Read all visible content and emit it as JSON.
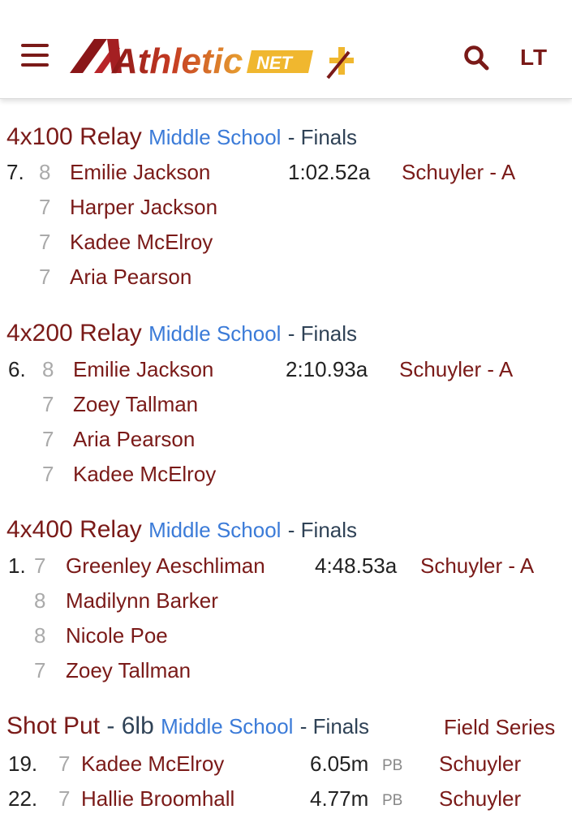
{
  "header": {
    "menu_icon": "hamburger-menu-icon",
    "logo": {
      "text_athletic": "Athletic",
      "text_net": "NET",
      "plus": "+"
    },
    "search_icon": "search-icon",
    "user_initials": "LT",
    "colors": {
      "brand": "#7a1a18",
      "accent": "#f0b72f",
      "link": "#3b7bd8"
    }
  },
  "events": [
    {
      "name": "4x100 Relay",
      "level": "Middle School",
      "round": "- Finals",
      "place": "7.",
      "mark": "1:02.52a",
      "team": "Schuyler - A",
      "athletes": [
        {
          "grade": "8",
          "name": "Emilie Jackson"
        },
        {
          "grade": "7",
          "name": "Harper Jackson"
        },
        {
          "grade": "7",
          "name": "Kadee McElroy"
        },
        {
          "grade": "7",
          "name": "Aria Pearson"
        }
      ]
    },
    {
      "name": "4x200 Relay",
      "level": "Middle School",
      "round": "- Finals",
      "place": "6.",
      "mark": "2:10.93a",
      "team": "Schuyler - A",
      "athletes": [
        {
          "grade": "8",
          "name": "Emilie Jackson"
        },
        {
          "grade": "7",
          "name": "Zoey Tallman"
        },
        {
          "grade": "7",
          "name": "Aria Pearson"
        },
        {
          "grade": "7",
          "name": "Kadee McElroy"
        }
      ]
    },
    {
      "name": "4x400 Relay",
      "level": "Middle School",
      "round": "- Finals",
      "place": "1.",
      "mark": "4:48.53a",
      "team": "Schuyler - A",
      "athletes": [
        {
          "grade": "7",
          "name": "Greenley Aeschliman"
        },
        {
          "grade": "8",
          "name": "Madilynn Barker"
        },
        {
          "grade": "8",
          "name": "Nicole Poe"
        },
        {
          "grade": "7",
          "name": "Zoey Tallman"
        }
      ]
    },
    {
      "name": "Shot Put",
      "weight": "- 6lb",
      "level": "Middle School",
      "round": "- Finals",
      "series": "Field Series",
      "results": [
        {
          "place": "19.",
          "grade": "7",
          "name": "Kadee McElroy",
          "mark": "6.05m",
          "pb": "PB",
          "team": "Schuyler"
        },
        {
          "place": "22.",
          "grade": "7",
          "name": "Hallie Broomhall",
          "mark": "4.77m",
          "pb": "PB",
          "team": "Schuyler"
        }
      ]
    }
  ]
}
